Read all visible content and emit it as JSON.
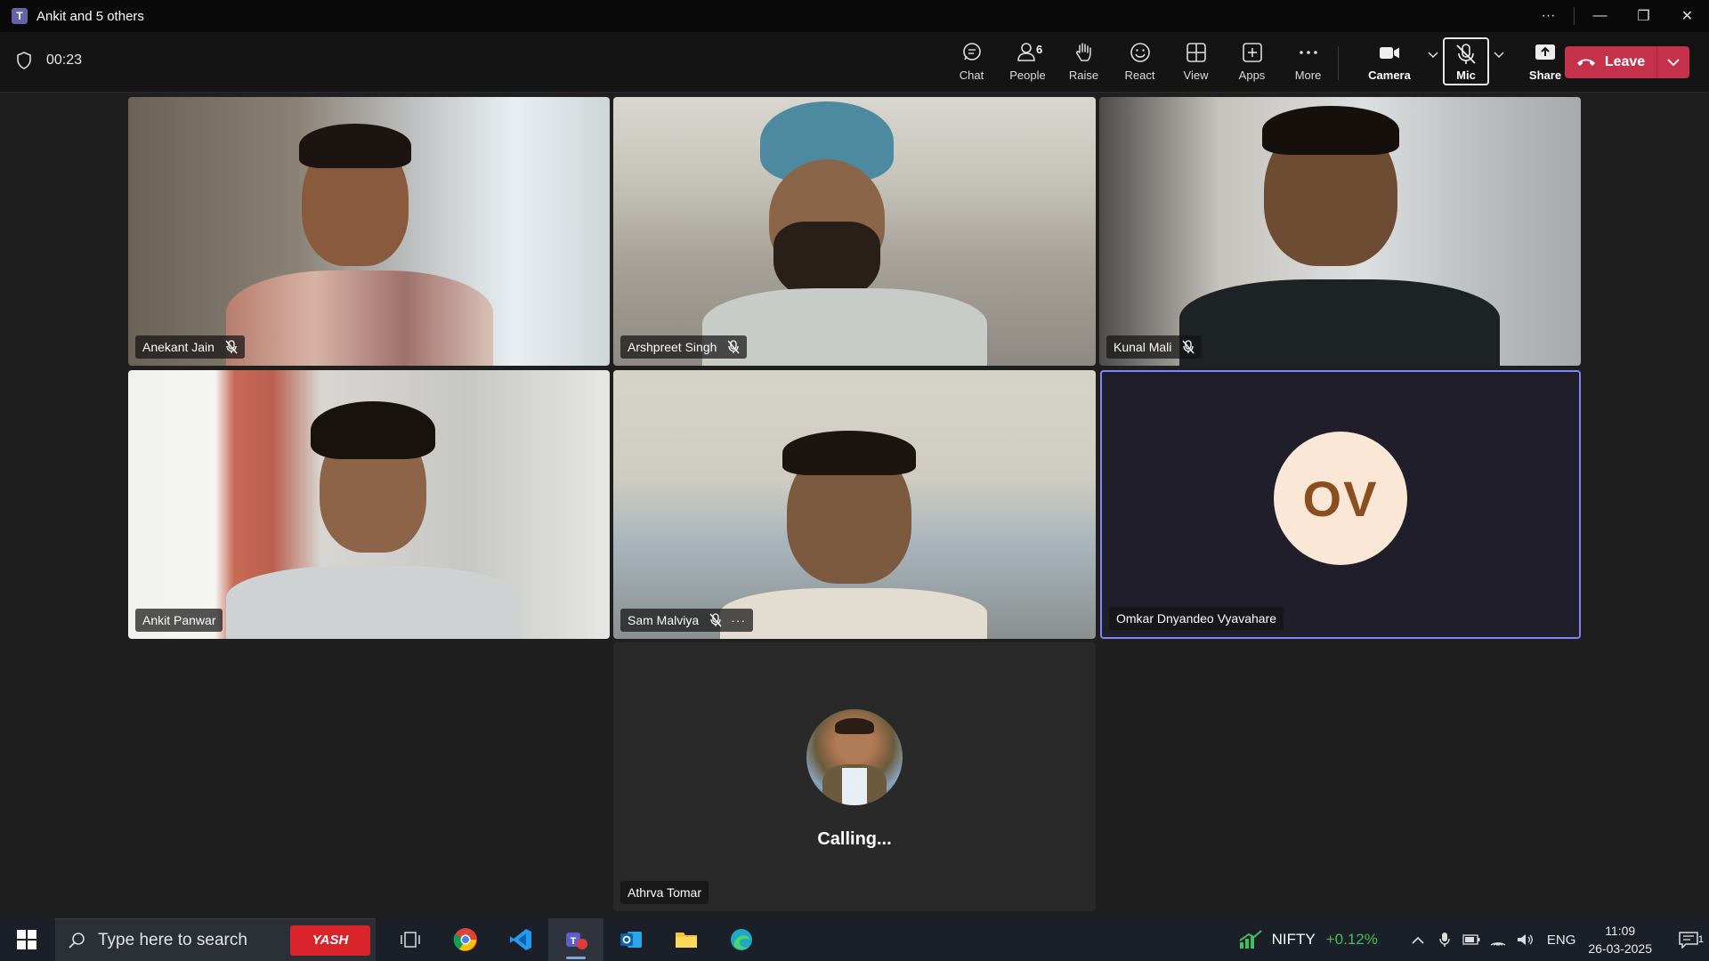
{
  "window": {
    "title": "Ankit and 5 others",
    "more": "···",
    "minimize": "—",
    "restore": "❐",
    "close": "✕"
  },
  "meeting": {
    "timer": "00:23",
    "tools": [
      {
        "id": "chat",
        "label": "Chat"
      },
      {
        "id": "people",
        "label": "People",
        "badge": "6"
      },
      {
        "id": "raise",
        "label": "Raise"
      },
      {
        "id": "react",
        "label": "React"
      },
      {
        "id": "view",
        "label": "View"
      },
      {
        "id": "apps",
        "label": "Apps"
      },
      {
        "id": "more",
        "label": "More"
      }
    ],
    "camera_label": "Camera",
    "mic_label": "Mic",
    "share_label": "Share",
    "leave_label": "Leave"
  },
  "participants": [
    {
      "name": "Anekant Jain",
      "muted": true
    },
    {
      "name": "Arshpreet Singh",
      "muted": true
    },
    {
      "name": "Kunal Mali",
      "muted": true
    },
    {
      "name": "Ankit Panwar",
      "muted": false
    },
    {
      "name": "Sam Malviya",
      "muted": true,
      "more": "···"
    },
    {
      "name": "Omkar Dnyandeo Vyavahare",
      "initials": "OV",
      "muted": false
    },
    {
      "name": "Athrva Tomar",
      "status": "Calling..."
    }
  ],
  "taskbar": {
    "search_placeholder": "Type here to search",
    "yash_label": "YASH",
    "nifty_label": "NIFTY",
    "nifty_change": "+0.12%",
    "language": "ENG",
    "time": "11:09",
    "date": "26-03-2025",
    "notifications": "1"
  },
  "colors": {
    "leave": "#c4314b",
    "accent_border": "#7f85f5",
    "avatar_bg": "#fbe7d6",
    "avatar_text": "#8b4f1f",
    "nifty_up": "#3fbf5f"
  }
}
